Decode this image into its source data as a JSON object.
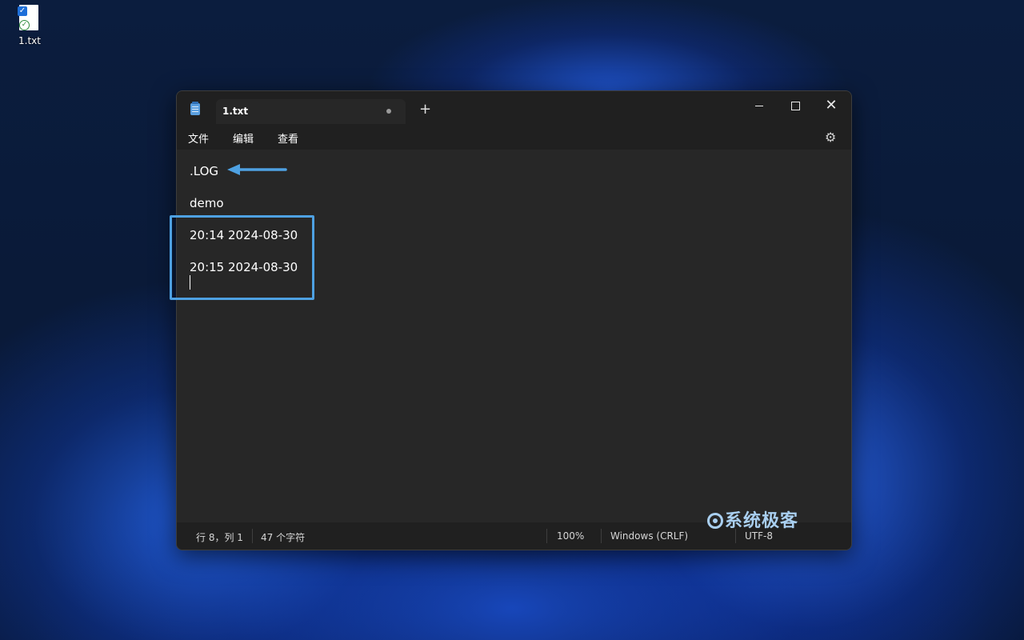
{
  "desktop": {
    "icon_label": "1.txt"
  },
  "window": {
    "tab_title": "1.txt",
    "new_tab": "+",
    "minimize_icon": "minimize-icon",
    "maximize_icon": "maximize-icon",
    "close_glyph": "✕"
  },
  "menu": {
    "file": "文件",
    "edit": "编辑",
    "view": "查看",
    "settings_glyph": "⚙"
  },
  "editor": {
    "lines": [
      ".LOG",
      "demo",
      "20:14 2024-08-30",
      "20:15 2024-08-30"
    ]
  },
  "status": {
    "position": "行 8，列 1",
    "char_count": "47 个字符",
    "zoom": "100%",
    "line_ending": "Windows (CRLF)",
    "encoding": "UTF-8"
  },
  "watermark": {
    "text": "系统极客"
  },
  "colors": {
    "annotation": "#4ea1e2",
    "editor_bg": "#272727",
    "chrome_bg": "#202020"
  }
}
